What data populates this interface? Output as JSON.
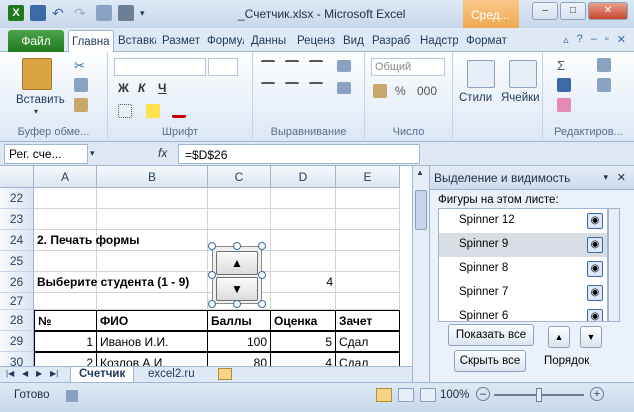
{
  "window": {
    "title": "_Счетчик.xlsx - Microsoft Excel",
    "context_tab": "Сред...",
    "minimize": "–",
    "maximize": "□",
    "close": "✕"
  },
  "tabs": {
    "file": "Файл",
    "items": [
      "Главна",
      "Вставка",
      "Разметка",
      "Формулы",
      "Данные",
      "Рецензирование",
      "Вид",
      "Разработчик",
      "Надстройки",
      "Формат"
    ]
  },
  "ribbon": {
    "paste": "Вставить",
    "font_name": "",
    "font_size": "",
    "bold": "Ж",
    "italic": "К",
    "underline": "Ч",
    "number_format": "Общий",
    "styles": "Стили",
    "cells": "Ячейки",
    "groups": [
      "Буфер обме...",
      "Шрифт",
      "Выравнивание",
      "Число",
      "Редактиров..."
    ]
  },
  "formula_bar": {
    "name_box": "Рег. сче...",
    "fx": "fx",
    "formula": "=$D$26"
  },
  "grid": {
    "columns": [
      "A",
      "B",
      "C",
      "D",
      "E"
    ],
    "rows": [
      "22",
      "23",
      "24",
      "25",
      "26",
      "27",
      "28",
      "29",
      "30"
    ],
    "r24": "2. Печать формы",
    "r26_label": "Выберите студента (1 - 9)",
    "r26_value": "4",
    "headers": [
      "№",
      "ФИО",
      "Баллы",
      "Оценка",
      "Зачет"
    ],
    "row29": [
      "1",
      "Иванов И.И.",
      "100",
      "5",
      "Сдал"
    ],
    "row30": [
      "2",
      "Козлов А.И.",
      "80",
      "4",
      "Сдал"
    ]
  },
  "spinner": {
    "up": "▲",
    "down": "▼"
  },
  "sheets": {
    "tabs": [
      "Счетчик",
      "excel2.ru"
    ]
  },
  "panel": {
    "title": "Выделение и видимость",
    "label": "Фигуры на этом листе:",
    "items": [
      "Spinner 12",
      "Spinner 9",
      "Spinner 8",
      "Spinner 7",
      "Spinner 6"
    ],
    "show_all": "Показать все",
    "hide_all": "Скрыть все",
    "order": "Порядок"
  },
  "status": {
    "ready": "Готово",
    "zoom": "100%"
  }
}
